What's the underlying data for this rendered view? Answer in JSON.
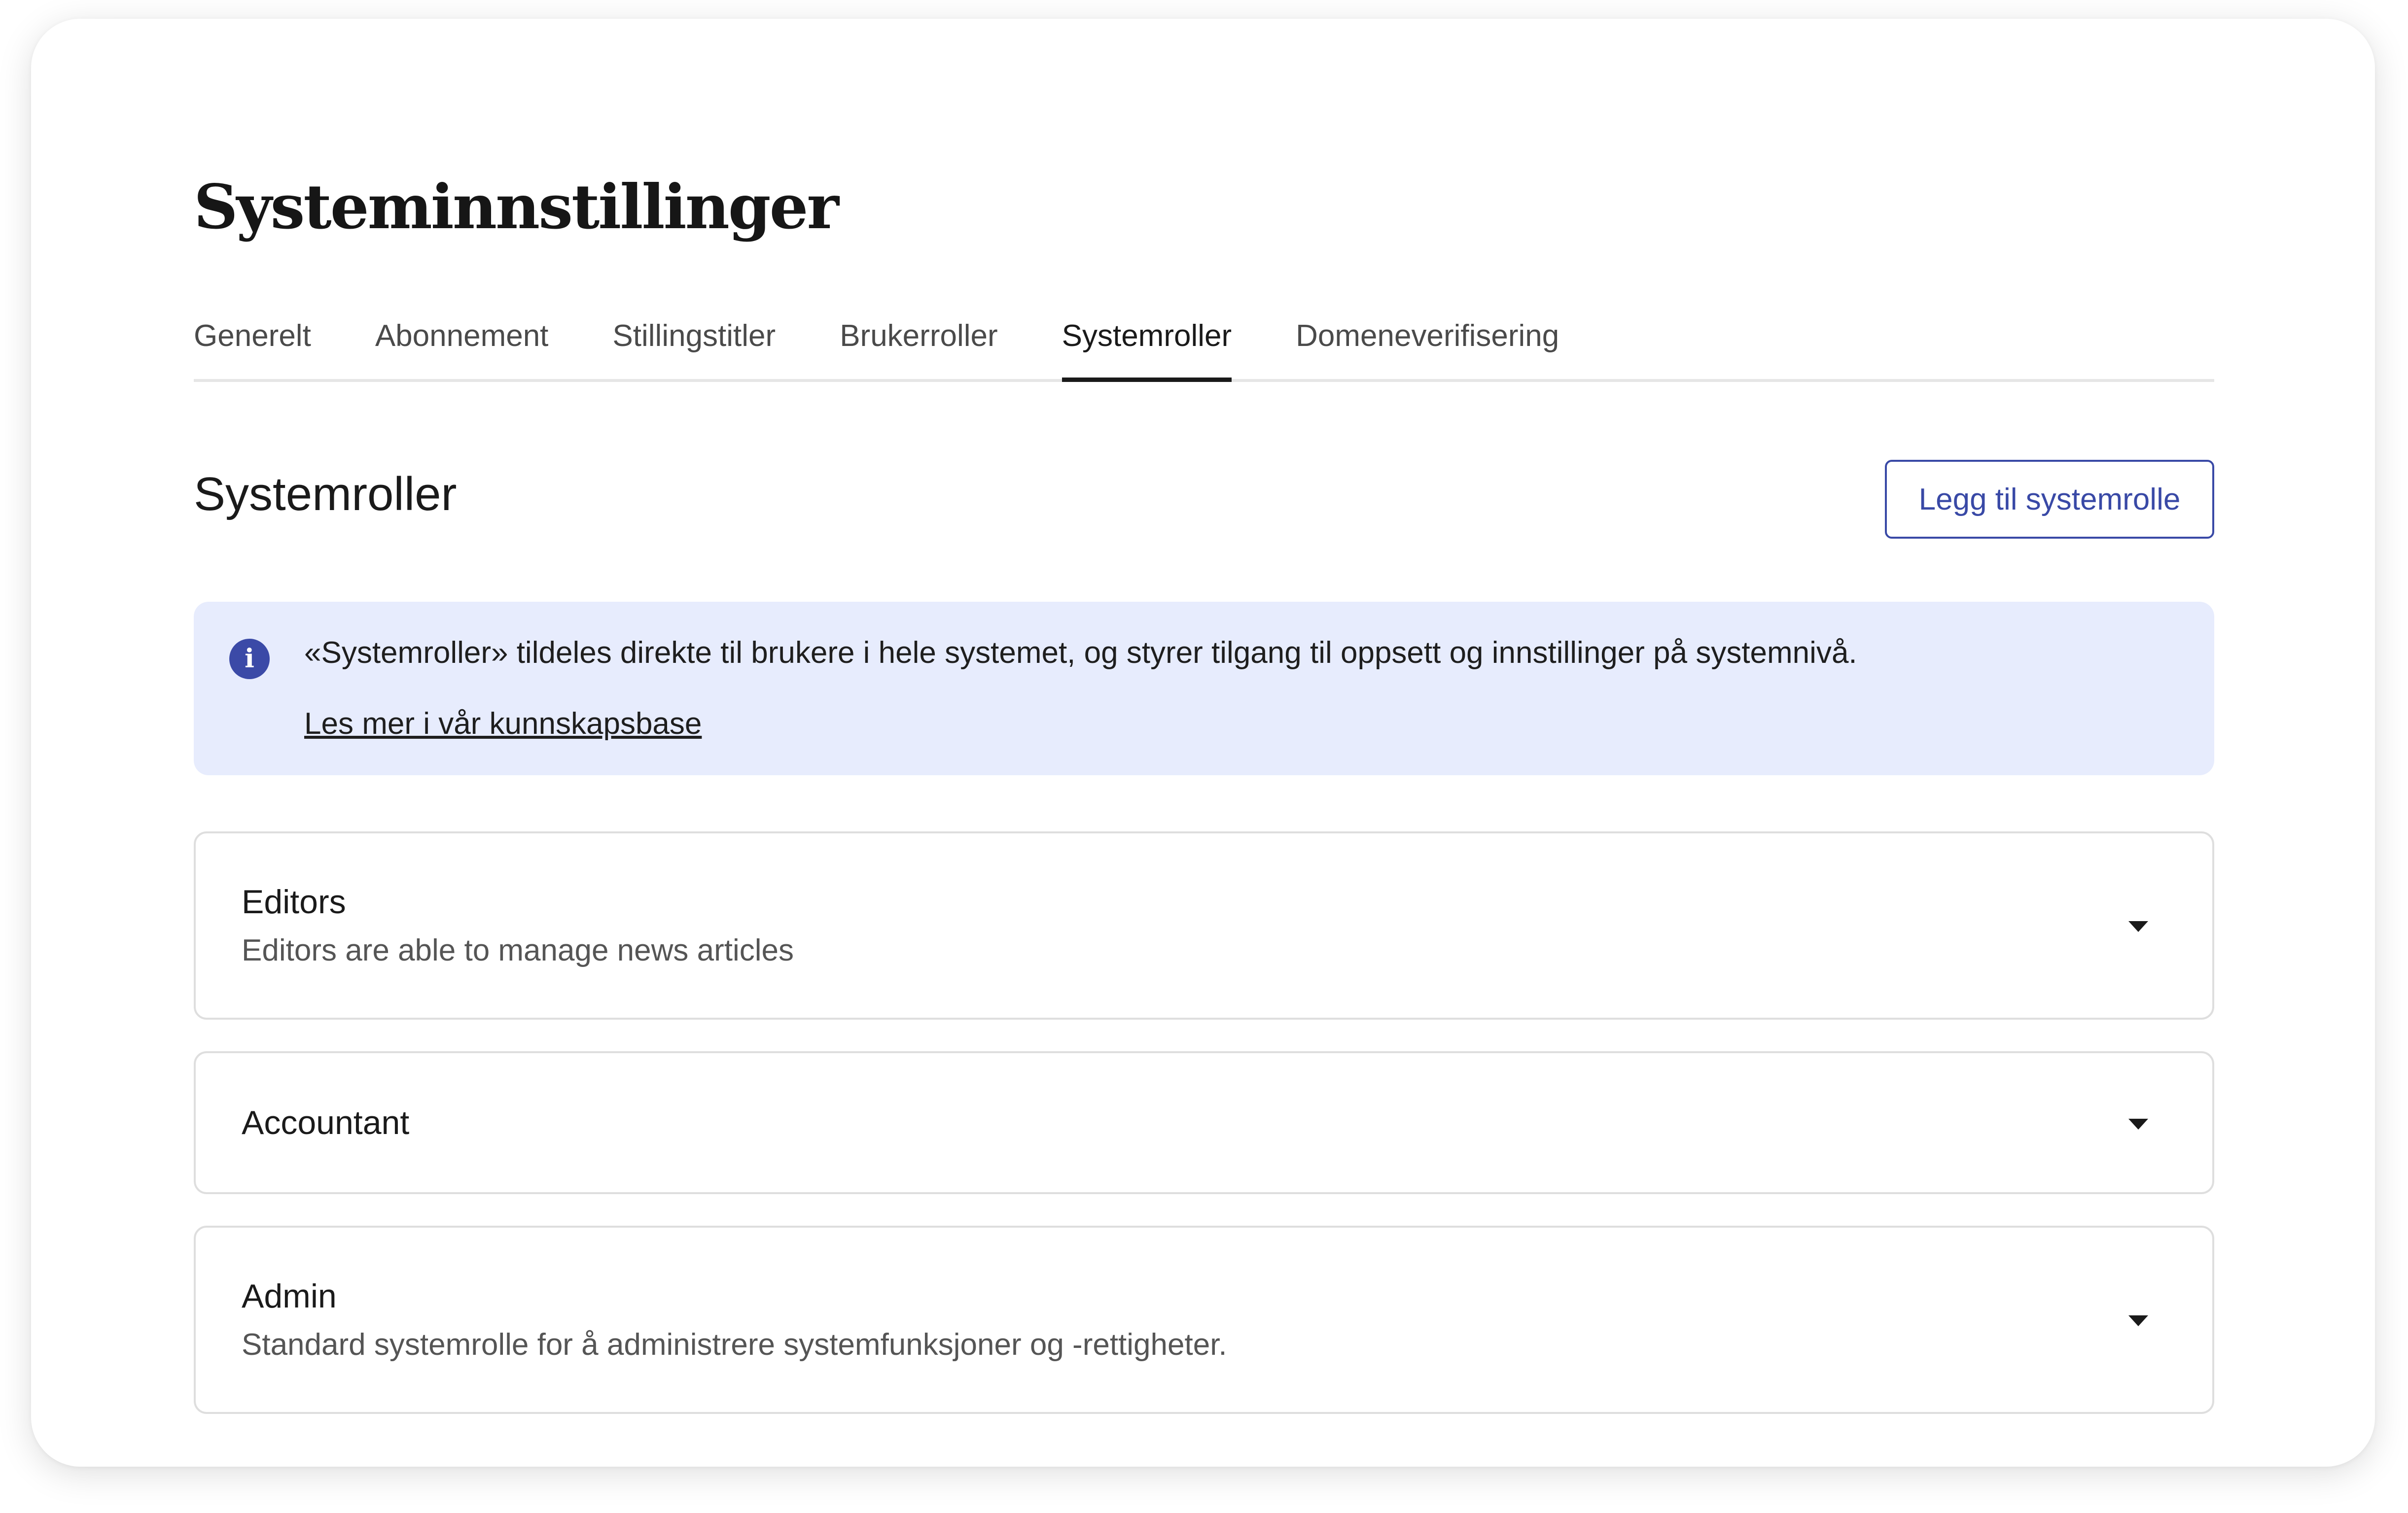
{
  "header": {
    "title": "Systeminnstillinger"
  },
  "tabs": [
    {
      "label": "Generelt",
      "active": false
    },
    {
      "label": "Abonnement",
      "active": false
    },
    {
      "label": "Stillingstitler",
      "active": false
    },
    {
      "label": "Brukerroller",
      "active": false
    },
    {
      "label": "Systemroller",
      "active": true
    },
    {
      "label": "Domeneverifisering",
      "active": false
    }
  ],
  "section": {
    "title": "Systemroller",
    "add_button_label": "Legg til systemrolle"
  },
  "info": {
    "icon": "info-icon",
    "icon_glyph": "i",
    "text": "«Systemroller» tildeles direkte til brukere i hele systemet, og styrer tilgang til oppsett og innstillinger på systemnivå.",
    "link_label": "Les mer i vår kunnskapsbase"
  },
  "roles": [
    {
      "name": "Editors",
      "description": "Editors are able to manage news articles"
    },
    {
      "name": "Accountant",
      "description": ""
    },
    {
      "name": "Admin",
      "description": "Standard systemrolle for å administrere systemfunksjoner og -rettigheter."
    }
  ],
  "colors": {
    "accent": "#3949a6",
    "info_background": "#e7ecfd",
    "border": "#dedede"
  }
}
